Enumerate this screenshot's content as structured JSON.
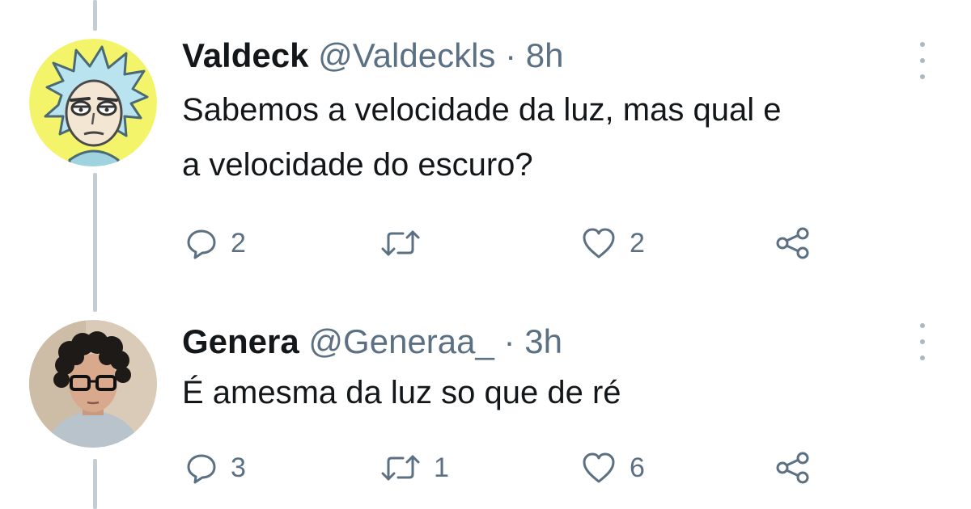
{
  "tweets": [
    {
      "display_name": "Valdeck",
      "handle": "@Valdeckls",
      "separator": "·",
      "time": "8h",
      "text_lines": [
        "Sabemos a velocidade da luz, mas qual e",
        "a velocidade do escuro?"
      ],
      "avatar_icon": "rick-cartoon-avatar",
      "avatar_bg": "#f4f46a",
      "actions": {
        "reply_count": "2",
        "retweet_count": "",
        "like_count": "2"
      }
    },
    {
      "display_name": "Genera",
      "handle": "@Generaa_",
      "separator": "·",
      "time": "3h",
      "text_lines": [
        "É amesma da luz so que de ré"
      ],
      "avatar_icon": "person-with-glasses-avatar",
      "avatar_bg": "#d9cbb7",
      "actions": {
        "reply_count": "3",
        "retweet_count": "1",
        "like_count": "6"
      }
    }
  ],
  "colors": {
    "text": "#14171a",
    "secondary": "#5b7083",
    "thread_line": "#c4cdd4"
  }
}
